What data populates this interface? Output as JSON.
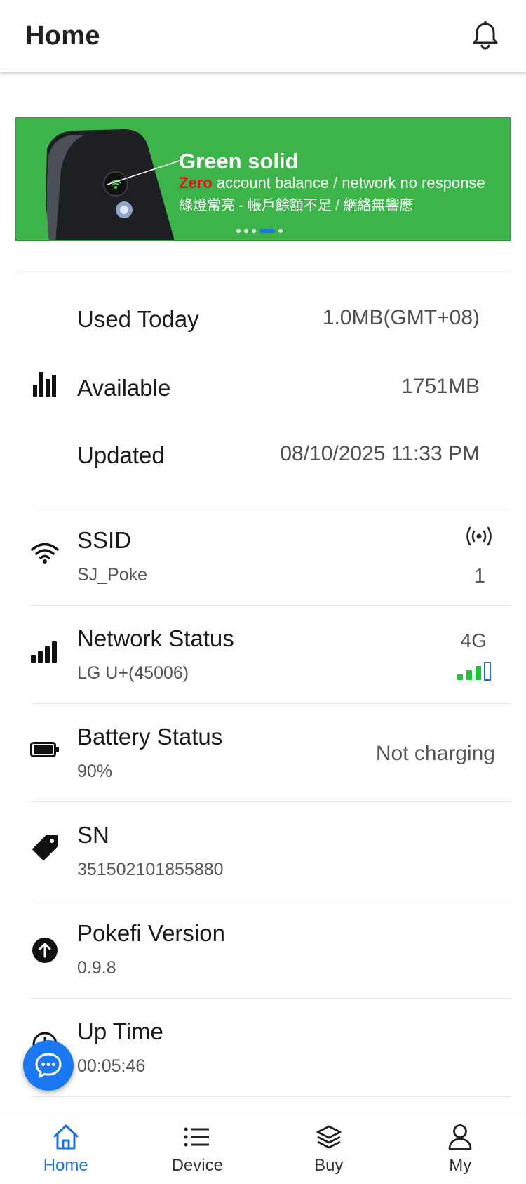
{
  "header": {
    "title": "Home",
    "bell_icon": "bell-icon"
  },
  "banner": {
    "title": "Green solid",
    "zero_word": "Zero",
    "line1_rest": " account balance / network no response",
    "line2": "綠燈常亮 - 帳戶餘額不足 / 網絡無響應",
    "slide_count": 5,
    "active_slide": 3
  },
  "usage": {
    "used_today": {
      "label": "Used Today",
      "value": "1.0MB(GMT+08)"
    },
    "available": {
      "label": "Available",
      "value": "1751MB"
    },
    "updated": {
      "label": "Updated",
      "value": "08/10/2025 11:33 PM"
    }
  },
  "info": {
    "ssid": {
      "title": "SSID",
      "value": "SJ_Poke",
      "connected_count": "1"
    },
    "network": {
      "title": "Network Status",
      "value": "LG U+(45006)",
      "tech": "4G",
      "signal_bars": 3,
      "signal_max": 4
    },
    "battery": {
      "title": "Battery Status",
      "value": "90%",
      "charging": "Not charging"
    },
    "sn": {
      "title": "SN",
      "value": "351502101855880"
    },
    "version": {
      "title": "Pokefi Version",
      "value": "0.9.8"
    },
    "uptime": {
      "title": "Up Time",
      "value": "00:05:46"
    }
  },
  "nav": {
    "items": [
      {
        "label": "Home",
        "icon": "home-icon",
        "active": true
      },
      {
        "label": "Device",
        "icon": "list-icon",
        "active": false
      },
      {
        "label": "Buy",
        "icon": "layers-icon",
        "active": false
      },
      {
        "label": "My",
        "icon": "user-icon",
        "active": false
      }
    ]
  },
  "colors": {
    "accent": "#1b78f2",
    "banner_green": "#3cb44a",
    "signal_green": "#1fc23a"
  }
}
